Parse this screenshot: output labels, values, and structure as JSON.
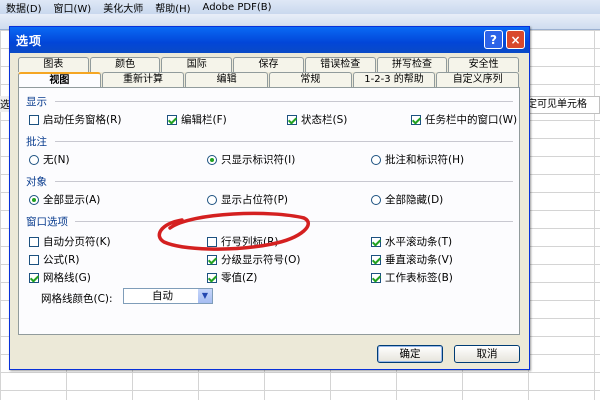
{
  "background": {
    "menu": [
      "数据(D)",
      "窗口(W)",
      "美化大师",
      "帮助(H)",
      "Adobe PDF(B)"
    ],
    "right_text": "定可见单元格",
    "left_text": "选"
  },
  "dialog": {
    "title": "选项",
    "help_label": "?",
    "close_label": "×",
    "tabs_row1": [
      "图表",
      "颜色",
      "国际",
      "保存",
      "错误检查",
      "拼写检查",
      "安全性"
    ],
    "tabs_row2": [
      "视图",
      "重新计算",
      "编辑",
      "常规",
      "1-2-3 的帮助",
      "自定义序列"
    ],
    "active_tab": "视图",
    "sections": {
      "display": {
        "title": "显示",
        "items": [
          {
            "label": "启动任务窗格(R)",
            "checked": false
          },
          {
            "label": "编辑栏(F)",
            "checked": true
          },
          {
            "label": "状态栏(S)",
            "checked": true
          },
          {
            "label": "任务栏中的窗口(W)",
            "checked": true
          }
        ]
      },
      "comments": {
        "title": "批注",
        "items": [
          {
            "label": "无(N)",
            "selected": false
          },
          {
            "label": "只显示标识符(I)",
            "selected": true
          },
          {
            "label": "批注和标识符(H)",
            "selected": false
          }
        ]
      },
      "objects": {
        "title": "对象",
        "items": [
          {
            "label": "全部显示(A)",
            "selected": true
          },
          {
            "label": "显示占位符(P)",
            "selected": false
          },
          {
            "label": "全部隐藏(D)",
            "selected": false
          }
        ]
      },
      "window": {
        "title": "窗口选项",
        "items": [
          {
            "label": "自动分页符(K)",
            "checked": false
          },
          {
            "label": "行号列标(R)",
            "checked": false
          },
          {
            "label": "水平滚动条(T)",
            "checked": true
          },
          {
            "label": "公式(R)",
            "checked": false
          },
          {
            "label": "分级显示符号(O)",
            "checked": true
          },
          {
            "label": "垂直滚动条(V)",
            "checked": true
          },
          {
            "label": "网格线(G)",
            "checked": true
          },
          {
            "label": "零值(Z)",
            "checked": true
          },
          {
            "label": "工作表标签(B)",
            "checked": true
          }
        ],
        "gridline_color_label": "网格线颜色(C):",
        "gridline_color_value": "自动"
      }
    },
    "buttons": {
      "ok": "确定",
      "cancel": "取消"
    },
    "annotation_color": "#d42020"
  }
}
